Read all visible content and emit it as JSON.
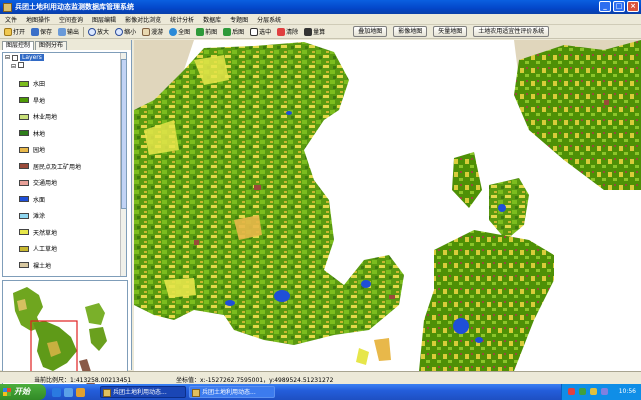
{
  "window": {
    "title": "兵团土地利用动态监测数据库管理系统",
    "controls": [
      "minimize",
      "maximize",
      "close"
    ]
  },
  "menu": [
    "文件",
    "地图操作",
    "空间查询",
    "图层编辑",
    "影像对比浏览",
    "统计分析",
    "数据库",
    "专题图",
    "分层系统"
  ],
  "toolbar": {
    "tools": [
      {
        "label": "打开",
        "icon": "folder-icon"
      },
      {
        "label": "保存",
        "icon": "save-icon"
      },
      {
        "label": "输出",
        "icon": "export-icon"
      },
      {
        "label": "放大",
        "icon": "zoom-in-icon"
      },
      {
        "label": "缩小",
        "icon": "zoom-out-icon"
      },
      {
        "label": "漫游",
        "icon": "pan-icon"
      },
      {
        "label": "全图",
        "icon": "globe-icon"
      },
      {
        "label": "前图",
        "icon": "previous-extent-icon"
      },
      {
        "label": "后图",
        "icon": "next-extent-icon"
      },
      {
        "label": "选中",
        "icon": "select-icon"
      },
      {
        "label": "清除",
        "icon": "clear-icon"
      },
      {
        "label": "量算",
        "icon": "measure-icon"
      }
    ],
    "actions": [
      "叠加地图",
      "影像地图",
      "矢量地图",
      "土地农用适宜性评价系统"
    ]
  },
  "left_panel": {
    "tabs": [
      "图层控制",
      "图例分布"
    ],
    "active_tab": 0,
    "layer_name": "Layers",
    "legend": [
      {
        "label": "水田",
        "color": "#7cbd1e"
      },
      {
        "label": "旱地",
        "color": "#4e9a06"
      },
      {
        "label": "林业用地",
        "color": "#c9e07a"
      },
      {
        "label": "林地",
        "color": "#2e7d1a"
      },
      {
        "label": "园地",
        "color": "#e8b84a"
      },
      {
        "label": "居民点及工矿用地",
        "color": "#9a4a3a"
      },
      {
        "label": "交通用地",
        "color": "#e8a098"
      },
      {
        "label": "水面",
        "color": "#1f4fd8"
      },
      {
        "label": "滩涂",
        "color": "#8fd6f0"
      },
      {
        "label": "天然草地",
        "color": "#e6e64a"
      },
      {
        "label": "人工草地",
        "color": "#c8b830"
      },
      {
        "label": "裸土地",
        "color": "#d8c8a0"
      }
    ]
  },
  "status": {
    "scale_label": "当前比例尺：1:413258.00213451",
    "coord_label": "坐标值：x:-1527262.7595001，y:4989524.51231272"
  },
  "taskbar": {
    "start_label": "开始",
    "tasks": [
      "兵团土地利用动态...",
      "兵团土地利用动态..."
    ],
    "clock": "10:56"
  }
}
